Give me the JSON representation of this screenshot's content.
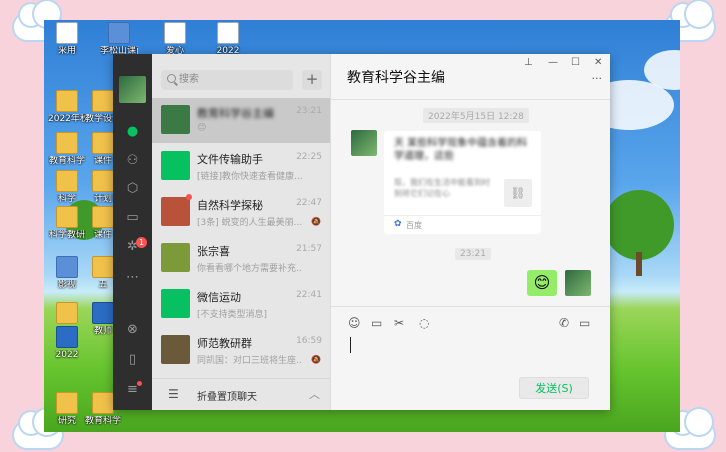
{
  "desktop": {
    "icons": [
      {
        "label": "采用",
        "kind": "doc"
      },
      {
        "label": "李松山课前五",
        "kind": "img"
      },
      {
        "label": "爱心",
        "kind": "doc"
      },
      {
        "label": "2022",
        "kind": "doc"
      },
      {
        "label": "2022年秋季",
        "kind": "folder"
      },
      {
        "label": "教学设计",
        "kind": "folder"
      },
      {
        "label": "教育科学",
        "kind": "folder"
      },
      {
        "label": "课件",
        "kind": "folder"
      },
      {
        "label": "科学",
        "kind": "folder"
      },
      {
        "label": "计划",
        "kind": "folder"
      },
      {
        "label": "科学教研",
        "kind": "folder"
      },
      {
        "label": "课件",
        "kind": "folder"
      },
      {
        "label": "影视",
        "kind": "img"
      },
      {
        "label": "五",
        "kind": "folder"
      },
      {
        "label": "教研",
        "kind": "folder"
      },
      {
        "label": "教师",
        "kind": "word"
      },
      {
        "label": "2022",
        "kind": "word"
      },
      {
        "label": "研究",
        "kind": "folder"
      },
      {
        "label": "教育科学",
        "kind": "folder"
      }
    ]
  },
  "wechat": {
    "search": {
      "placeholder": "搜索"
    },
    "add_label": "+",
    "chats": [
      {
        "name": "教育科学谷主编",
        "time": "23:21",
        "preview": "😊",
        "selected": true,
        "avatar_color": "#3c7a45",
        "muted": false,
        "red_dot": false
      },
      {
        "name": "文件传输助手",
        "time": "22:25",
        "preview": "[链接]教你快速查看健康...",
        "selected": false,
        "avatar_color": "#07c160",
        "muted": false,
        "red_dot": false
      },
      {
        "name": "自然科学探秘",
        "time": "22:47",
        "preview": "[3条] 蜕变的人生最美丽...",
        "selected": false,
        "avatar_color": "#b9523a",
        "muted": true,
        "red_dot": true
      },
      {
        "name": "张宗喜",
        "time": "21:57",
        "preview": "你看看哪个地方需要补充...",
        "selected": false,
        "avatar_color": "#7c9a3a",
        "muted": false,
        "red_dot": false
      },
      {
        "name": "微信运动",
        "time": "22:41",
        "preview": "[不支持类型消息]",
        "selected": false,
        "avatar_color": "#07c160",
        "muted": false,
        "red_dot": false
      },
      {
        "name": "师范教研群",
        "time": "16:59",
        "preview": "同凯国：对口三班将生座...",
        "selected": false,
        "avatar_color": "#6a5a3a",
        "muted": true,
        "red_dot": false
      }
    ],
    "fold_label": "折叠置顶聊天",
    "nav_badge": "1",
    "chat": {
      "title": "教育科学谷主编",
      "timestamp1": "2022年5月15日 12:28",
      "card_title": "天 某些科学现象中蕴含着的科学道理，这些",
      "card_desc": "现，我们在生活中能看到时刻将它们记在心",
      "card_source": "百度",
      "timestamp2": "23:21",
      "emoji_message": "😊",
      "send_label": "发送(S)"
    },
    "icons": {
      "chat": "chat-icon",
      "contacts": "contacts-icon",
      "favorites": "favorites-icon",
      "files": "folder-icon",
      "moments": "moments-icon",
      "more": "more-icon",
      "miniprogram": "miniprogram-icon",
      "phone": "phone-icon",
      "menu": "menu-icon"
    }
  }
}
